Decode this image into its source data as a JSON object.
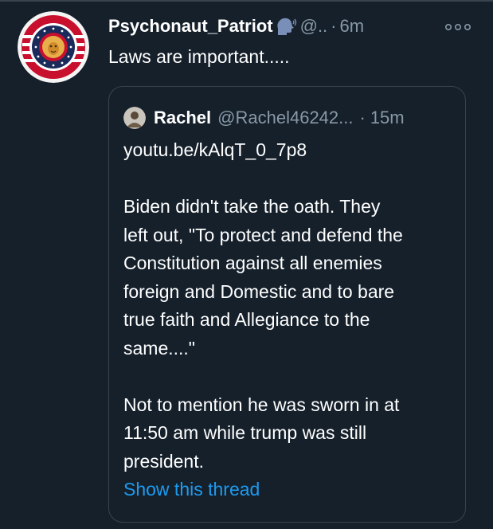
{
  "tweet": {
    "author": {
      "display_name": "Psychonaut_Patriot",
      "handle": "@..",
      "name_emoji_icon": "speaking-head-icon"
    },
    "separator": "·",
    "time": "6m",
    "text": "Laws are important.....",
    "more_icon": "more-options-icon"
  },
  "quoted_tweet": {
    "author": {
      "display_name": "Rachel",
      "handle": "@Rachel46242...",
      "avatar_icon": "user-avatar-icon"
    },
    "separator": "·",
    "time": "15m",
    "body_lines": [
      "youtu.be/kAlqT_0_7p8",
      "",
      "Biden didn't take the oath. They",
      "left out, \"To protect and defend the",
      "Constitution against all enemies",
      "foreign and Domestic and to bare",
      "true faith and Allegiance to the",
      "same....\"",
      "",
      "Not to mention he was sworn in at",
      "11:50 am while trump was still",
      "president."
    ],
    "show_thread_label": "Show this thread"
  },
  "colors": {
    "background": "#15202b",
    "primary_text": "#ffffff",
    "secondary_text": "#8899a6",
    "link": "#1d9bf0",
    "border": "#38444d"
  }
}
